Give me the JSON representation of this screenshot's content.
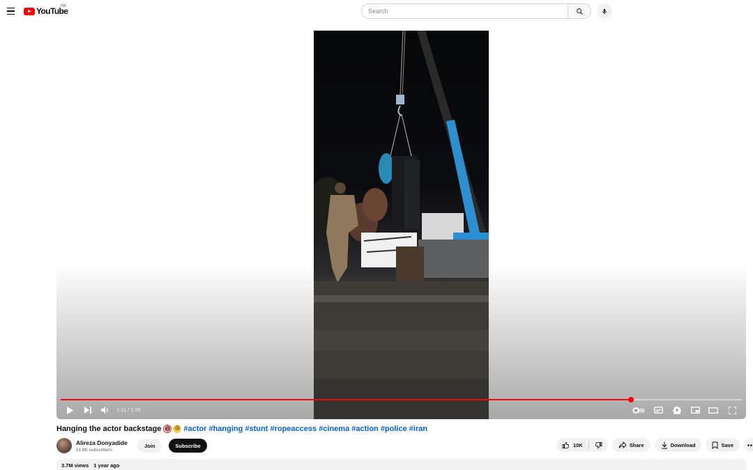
{
  "masthead": {
    "logo_text": "YouTube",
    "region": "HK",
    "search_placeholder": "Search"
  },
  "player": {
    "time": "1:11 / 1:26",
    "progress": 0.837
  },
  "video": {
    "title": "Hanging the actor backstage",
    "emoji_1": "🔞",
    "emoji_2": "😱",
    "hashtags": "#actor #hanging #stunt #ropeaccess #cinema #action #police #iran"
  },
  "channel": {
    "name": "Alireza Donyadide",
    "subscribers": "51.8K subscribers",
    "join_label": "Join",
    "subscribe_label": "Subscribe"
  },
  "actions": {
    "likes": "10K",
    "share_label": "Share",
    "download_label": "Download",
    "save_label": "Save"
  },
  "description": {
    "views": "3.7M views",
    "age": "1 year ago"
  },
  "colors": {
    "brand_red": "#ff0000",
    "link_blue": "#065fd4"
  }
}
